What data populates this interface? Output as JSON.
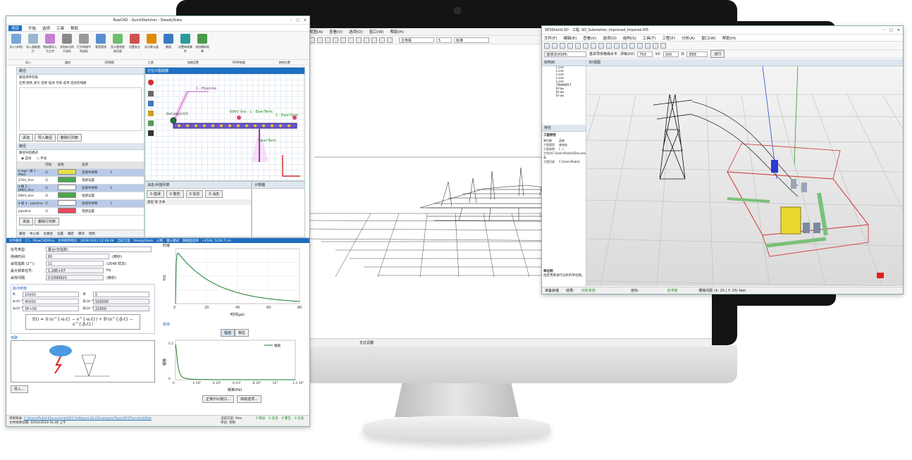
{
  "left_app": {
    "title": "RowCAD - QuickSketcher - SteadyState",
    "tabs": [
      "项目",
      "开始",
      "选项",
      "工具",
      "帮助"
    ],
    "ribbon_buttons": [
      "导入(本地)",
      "导入面板图片",
      "将标题导入为工作",
      "添加标记的大坐标",
      "打开网络中的坐标",
      "垂直视线",
      "显示更改更新页面",
      "设置安全",
      "显示默认值",
      "数值",
      "设置网络属性",
      "添加模拟结果"
    ],
    "ribbon_groups": [
      "导入",
      "路由",
      "3D视图",
      "工具",
      "电路设置",
      "ROW电路",
      "结构位置"
    ],
    "route_panel_title": "路径",
    "route_list_label": "路径清单列表",
    "route_columns": "启用 颜色 索引 名称 描述 可视 选项 连续的线路",
    "btn_add": "添加",
    "btn_import_path": "导入路径",
    "btn_delete_path": "删除行列表",
    "path_section": "路径",
    "path_mode_label": "路径导航模式",
    "radio_auto": "自动",
    "radio_manual": "手动",
    "table_headers": [
      "",
      "可视",
      "颜色",
      "选项"
    ],
    "table_rows": [
      {
        "name": "▾ sign: 帧 1 - Main",
        "opt": "连接导体和",
        "color": "#e8e04a",
        "num": "1"
      },
      {
        "name": "27kV_line",
        "opt": "电感设置",
        "color": "#4aa84a",
        "num": ""
      },
      {
        "name": "▾ 帧 2 - 69kV_line",
        "opt": "连接导体和",
        "color": "#ffffff",
        "num": "1"
      },
      {
        "name": "69kV_line",
        "opt": "电感设置",
        "color": "#4aa84a",
        "num": ""
      },
      {
        "name": "▾ 帧 3 - pipeline",
        "opt": "连接导体和",
        "color": "#ffffff",
        "num": "1"
      },
      {
        "name": "pipeline",
        "opt": "电感设置",
        "color": "#e84a5a",
        "num": ""
      }
    ],
    "bottom_tabs": [
      "路径",
      "中心线",
      "主路径",
      "设置",
      "确定",
      "模块",
      "结构"
    ],
    "sketch_title": "方位计图视器",
    "sketch_labels": {
      "pipeline": "1 - PipeLine",
      "line1": "69kV line - 1 - East-Term",
      "line2": "1 - East-Term",
      "west": "West-Term",
      "east": "East-Term",
      "comp": "DeComp1(ST)"
    },
    "messages_title": "消息/问题列表",
    "messages_counts": [
      "0 错误",
      "0 警告",
      "0 信息",
      "0 消息"
    ],
    "messages_cols": "类型 值 文本",
    "tab_list": "计数器",
    "status": {
      "file": "文件路径",
      "file_path": "C:\\...\\RowCAD\\Proj",
      "saved_label": "文件保存时间",
      "saved": "2019/10/11 22:08:48",
      "mode_label": "当前方案",
      "mode": "SteadyState",
      "unit": "公制",
      "coord_label": "输入模式",
      "coord": "数据面选择",
      "xy": "(-4506, 5228.7) m"
    }
  },
  "transient_app": {
    "signal_type_label": "信号类型:",
    "signal_type": "叠合(双指数)",
    "duration_label": "持续时间:",
    "duration": "80",
    "duration_unit": "(微秒)",
    "samples_label": "采样指数 (2^):",
    "samples": "11",
    "samples_note": "(2048 样本)",
    "max_freq_label": "最大频率信号:",
    "max_freq": "1.28E+07",
    "max_freq_unit": "Hz",
    "interval_label": "采样间隔:",
    "interval": "0.0390625",
    "interval_unit": "(微秒)",
    "params_title": "脉冲参数",
    "a_label": "A",
    "a_value": "10000",
    "b_label": "B",
    "b_value": "0",
    "alpha1_label": "α₁(s⁻¹)",
    "alpha1": "40000",
    "beta1_label": "β₁(s⁻¹)",
    "beta1": "100000",
    "alpha2_label": "α₂(s⁻¹)",
    "alpha2": "3E+06",
    "beta2_label": "β₂(s⁻¹)",
    "beta2": "22000",
    "formula": "f(t) = A·(e^{-α₁t} − e^{-α₂t}) + B·(e^{-β₁t} − e^{-β₂t})",
    "diagram_title": "电路",
    "import_btn": "导入...",
    "time_chart_title": "时域",
    "time_ylabel": "f(t)",
    "time_xlabel": "时间(µs)",
    "time_ticks": [
      "0",
      "20",
      "40",
      "60",
      "80"
    ],
    "freq_chart_title": "频谱",
    "freq_tab_mag": "幅值",
    "freq_tab_phase": "相位",
    "freq_ylabel": "幅值",
    "freq_xlabel": "频率(Hz)",
    "freq_yticks": [
      "0.2",
      "0"
    ],
    "freq_xticks": [
      "0",
      "2·10⁶",
      "4·10⁶",
      "6·10⁶",
      "8·10⁶",
      "10⁷",
      "1.2·10⁷"
    ],
    "legend": "幅值",
    "btn_normal": "正常(Hz)窗口...",
    "btn_advanced": "高级选项...",
    "status": {
      "proj_label": "项目目录:",
      "proj": "C:\\Users\\Public\\Documents\\SES Software\\16.2\\Examples\\Tools\\SESTransient\\Pole",
      "saved_label": "文件修改日期:",
      "saved": "10/10/2019 01:46 上午",
      "mode_label": "当前方案:",
      "mode": "Pole",
      "unit_label": "单位:",
      "unit": "英制",
      "counts": [
        "0 错误",
        "0 任务",
        "0 警告",
        "0 信息"
      ]
    }
  },
  "center_app": {
    "menu": [
      "视图(A)",
      "查看(V)",
      "选项(O)",
      "窗口(W)",
      "帮助(H)"
    ],
    "combo_color": "主电极",
    "combo_num": "5",
    "combo_std": "标准",
    "status": "无过滤器"
  },
  "right_app": {
    "title": "SESShield-3D - 工程: SD_Substation_Improved_Imperial.f05",
    "menu": [
      "文件(F)",
      "编辑(E)",
      "查看(V)",
      "选项(O)",
      "结构(S)",
      "工具(T)",
      "工程(P)",
      "分析(A)",
      "窗口(W)",
      "帮助(H)"
    ],
    "toolbar2": {
      "method": "滚球法(RSM)",
      "desc": "基本导体绝缘水平",
      "level_label": "评级(kV)",
      "voltage": "750",
      "voltage_unit": "kV",
      "res": "300",
      "res_unit": "Ω",
      "std": "IEEE",
      "run": "运行"
    },
    "tree_title": "结构树",
    "tree_items": [
      "Line",
      "Line",
      "Line",
      "Line",
      "Line",
      "TRANSMIT",
      "Draw",
      "Draw",
      "Draw"
    ],
    "view_title": "3D视图",
    "props_title": "特性",
    "props_group": "工程特性",
    "props": [
      {
        "k": "单位制",
        "v": "英制"
      },
      {
        "k": "工程类型",
        "v": "变电站"
      },
      {
        "k": "工程说明",
        "v": "(...)"
      },
      {
        "k": "工作目录",
        "v": "C:\\Users\\Public\\Docume"
      },
      {
        "k": "工程目录",
        "v": "C:\\Users\\Public"
      }
    ],
    "unit_hint_title": "单位制",
    "unit_hint": "指定用来进行分析的单位制。",
    "status": {
      "left": "准备就绪",
      "result": "结果:",
      "result_val": "分析状态",
      "coord": "坐标:",
      "warn": "无冲突",
      "grid": "栅格间距 (X: 25 | Y: 25) feet"
    }
  },
  "colors": {
    "accent": "#1f6fc2",
    "green": "#1b8a1b",
    "purple": "#7a3d9a",
    "orange": "#e08a00"
  }
}
